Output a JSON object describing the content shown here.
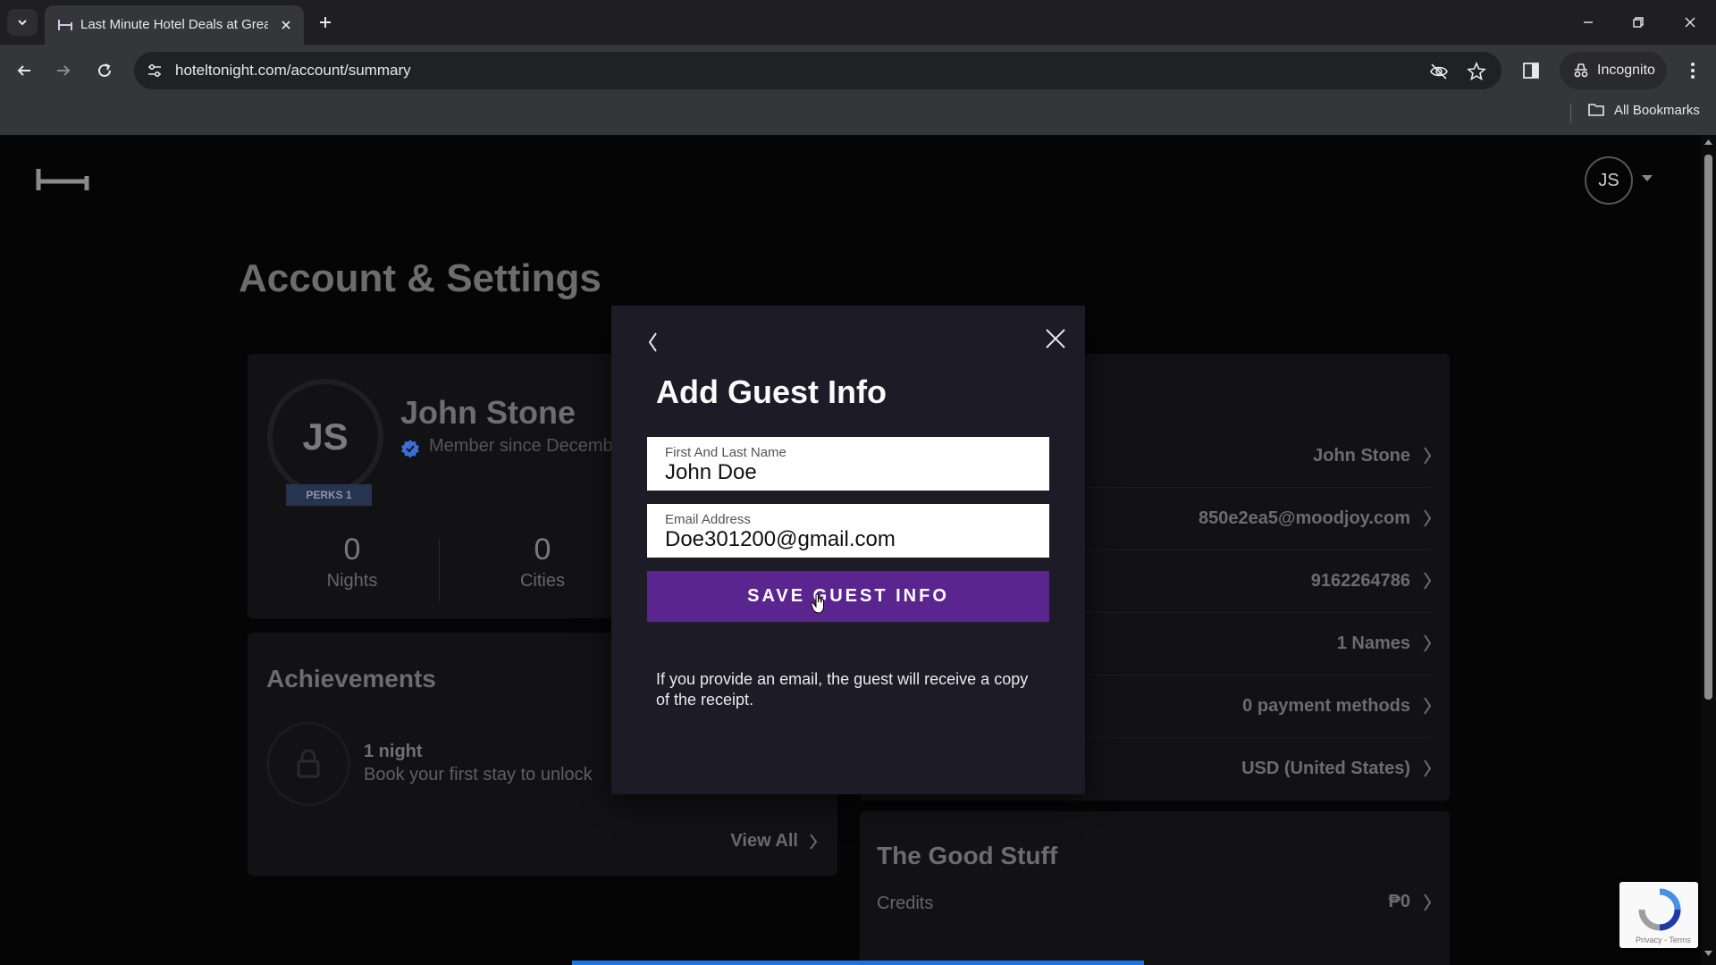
{
  "browser": {
    "tab_title": "Last Minute Hotel Deals at Great Prices",
    "url": "hoteltonight.com/account/summary",
    "incognito_label": "Incognito",
    "all_bookmarks": "All Bookmarks"
  },
  "header": {
    "avatar_initials": "JS"
  },
  "page": {
    "title": "Account & Settings"
  },
  "profile": {
    "initials": "JS",
    "perks_badge": "PERKS 1",
    "name": "John Stone",
    "member_since": "Member since December",
    "stats": [
      {
        "value": "0",
        "label": "Nights"
      },
      {
        "value": "0",
        "label": "Cities"
      }
    ]
  },
  "achievements": {
    "title": "Achievements",
    "item_name": "1 night",
    "item_desc": "Book your first stay to unlock",
    "view_all": "View All"
  },
  "settings": {
    "rows": [
      "John Stone",
      "850e2ea5@moodjoy.com",
      "9162264786",
      "1 Names",
      "0 payment methods",
      "USD (United States)"
    ]
  },
  "good_stuff": {
    "title": "The Good Stuff",
    "credits_label": "Credits",
    "credits_value": "₱0"
  },
  "modal": {
    "title": "Add Guest Info",
    "name_label": "First And Last Name",
    "name_value": "John Doe",
    "email_label": "Email Address",
    "email_value": "Doe301200@gmail.com",
    "save_label": "SAVE GUEST INFO",
    "note": "If you provide an email, the guest will receive a copy of the receipt."
  },
  "recaptcha": {
    "text": "Privacy - Terms"
  },
  "colors": {
    "save_button": "#5b2590",
    "modal_bg": "#1c1b26",
    "verified_badge": "#3b6fd6",
    "loading_bar": "#1a73e8"
  }
}
